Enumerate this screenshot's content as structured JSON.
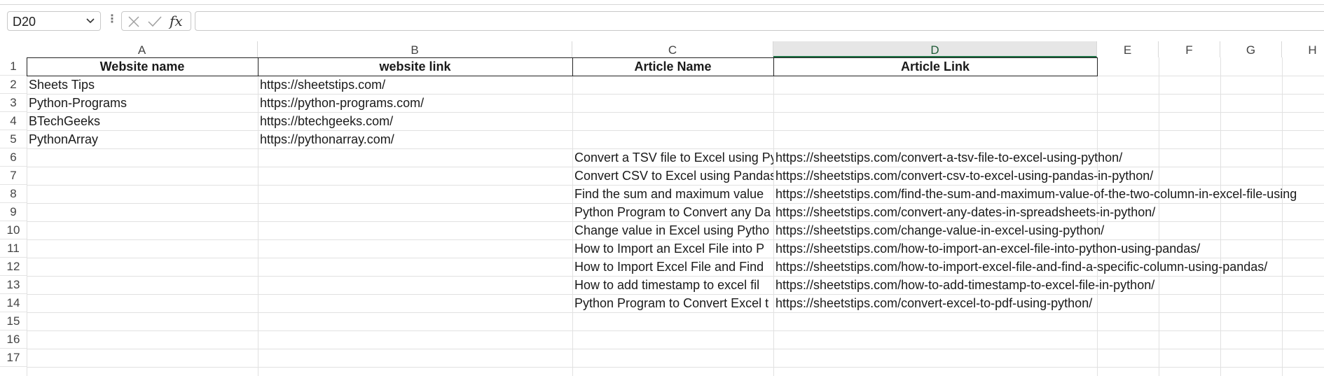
{
  "formula_bar": {
    "name_box": "D20",
    "name_box_dropdown_icon": "chevron-down-icon",
    "cancel_icon": "close-icon",
    "enter_icon": "checkmark-icon",
    "function_label": "fx",
    "formula_value": ""
  },
  "columns": [
    "A",
    "B",
    "C",
    "D",
    "E",
    "F",
    "G",
    "H"
  ],
  "active_column": "D",
  "rows": [
    "1",
    "2",
    "3",
    "4",
    "5",
    "6",
    "7",
    "8",
    "9",
    "10",
    "11",
    "12",
    "13",
    "14",
    "15",
    "16",
    "17"
  ],
  "headers": {
    "a": "Website name",
    "b": "website link",
    "c": "Article Name",
    "d": "Article Link"
  },
  "websites": [
    {
      "name": "Sheets Tips",
      "link": "https://sheetstips.com/"
    },
    {
      "name": "Python-Programs",
      "link": "https://python-programs.com/"
    },
    {
      "name": "BTechGeeks",
      "link": "https://btechgeeks.com/"
    },
    {
      "name": "PythonArray",
      "link": "https://pythonarray.com/"
    }
  ],
  "articles": [
    {
      "name": "Convert a TSV file to Excel using Py",
      "link": "https://sheetstips.com/convert-a-tsv-file-to-excel-using-python/"
    },
    {
      "name": "Convert CSV to Excel using Pandas",
      "link": "https://sheetstips.com/convert-csv-to-excel-using-pandas-in-python/"
    },
    {
      "name": "Find the sum and maximum value",
      "link": "https://sheetstips.com/find-the-sum-and-maximum-value-of-the-two-column-in-excel-file-using"
    },
    {
      "name": "Python Program to Convert any Da",
      "link": "https://sheetstips.com/convert-any-dates-in-spreadsheets-in-python/"
    },
    {
      "name": "Change value in Excel using Pytho",
      "link": "https://sheetstips.com/change-value-in-excel-using-python/"
    },
    {
      "name": "How to Import an Excel File into P",
      "link": "https://sheetstips.com/how-to-import-an-excel-file-into-python-using-pandas/"
    },
    {
      "name": "How to Import Excel File and Find",
      "link": "https://sheetstips.com/how-to-import-excel-file-and-find-a-specific-column-using-pandas/"
    },
    {
      "name": "How to add timestamp to excel fil",
      "link": "https://sheetstips.com/how-to-add-timestamp-to-excel-file-in-python/"
    },
    {
      "name": "Python Program to Convert Excel t",
      "link": "https://sheetstips.com/convert-excel-to-pdf-using-python/"
    }
  ],
  "colors": {
    "active_column_accent": "#1e7145",
    "gridline": "#e1e1e1",
    "header_border": "#222222"
  }
}
